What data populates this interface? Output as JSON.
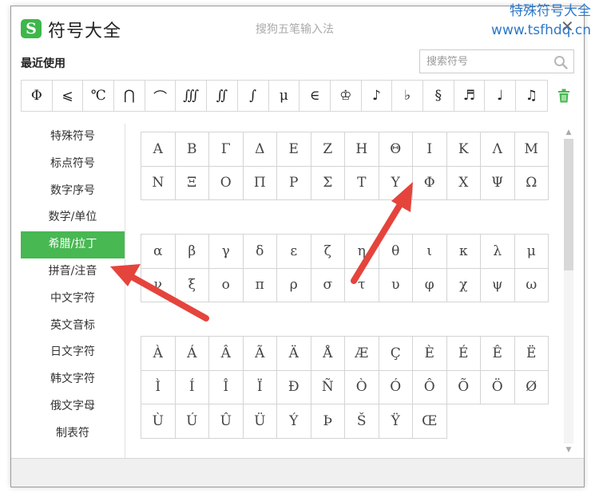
{
  "watermark": {
    "line1": "特殊符号大全",
    "line2": "www.tsfhdq.cn"
  },
  "window": {
    "logo_letter": "S",
    "title": "符号大全",
    "ime_name": "搜狗五笔输入法",
    "close_label": "✕"
  },
  "recent": {
    "label": "最近使用",
    "symbols": [
      "Φ",
      "⩽",
      "℃",
      "⋂",
      "⌒",
      "∭",
      "∬",
      "∫",
      "μ",
      "∈",
      "♔",
      "♪",
      "♭",
      "§",
      "♬",
      "♩",
      "♫"
    ]
  },
  "search": {
    "placeholder": "搜索符号",
    "value": ""
  },
  "categories": [
    {
      "label": "特殊符号",
      "active": false
    },
    {
      "label": "标点符号",
      "active": false
    },
    {
      "label": "数字序号",
      "active": false
    },
    {
      "label": "数学/单位",
      "active": false
    },
    {
      "label": "希腊/拉丁",
      "active": true
    },
    {
      "label": "拼音/注音",
      "active": false
    },
    {
      "label": "中文字符",
      "active": false
    },
    {
      "label": "英文音标",
      "active": false
    },
    {
      "label": "日文字符",
      "active": false
    },
    {
      "label": "韩文字符",
      "active": false
    },
    {
      "label": "俄文字母",
      "active": false
    },
    {
      "label": "制表符",
      "active": false
    }
  ],
  "groups": [
    {
      "symbols": [
        "Α",
        "Β",
        "Γ",
        "Δ",
        "Ε",
        "Ζ",
        "Η",
        "Θ",
        "Ι",
        "Κ",
        "Λ",
        "Μ",
        "Ν",
        "Ξ",
        "Ο",
        "Π",
        "Ρ",
        "Σ",
        "Τ",
        "Υ",
        "Φ",
        "Χ",
        "Ψ",
        "Ω"
      ]
    },
    {
      "symbols": [
        "α",
        "β",
        "γ",
        "δ",
        "ε",
        "ζ",
        "η",
        "θ",
        "ι",
        "κ",
        "λ",
        "μ",
        "ν",
        "ξ",
        "ο",
        "π",
        "ρ",
        "σ",
        "τ",
        "υ",
        "φ",
        "χ",
        "ψ",
        "ω"
      ]
    },
    {
      "symbols": [
        "À",
        "Á",
        "Â",
        "Ã",
        "Ä",
        "Å",
        "Æ",
        "Ç",
        "È",
        "É",
        "Ê",
        "Ë",
        "Ì",
        "Í",
        "Î",
        "Ï",
        "Ð",
        "Ñ",
        "Ò",
        "Ó",
        "Ô",
        "Õ",
        "Ö",
        "Ø",
        "Ù",
        "Ú",
        "Û",
        "Ü",
        "Ý",
        "Þ",
        "Š",
        "Ÿ",
        "Œ"
      ]
    }
  ],
  "colors": {
    "accent": "#47b852",
    "watermark": "#2c78c8",
    "annotation_arrow": "#e5443c"
  }
}
